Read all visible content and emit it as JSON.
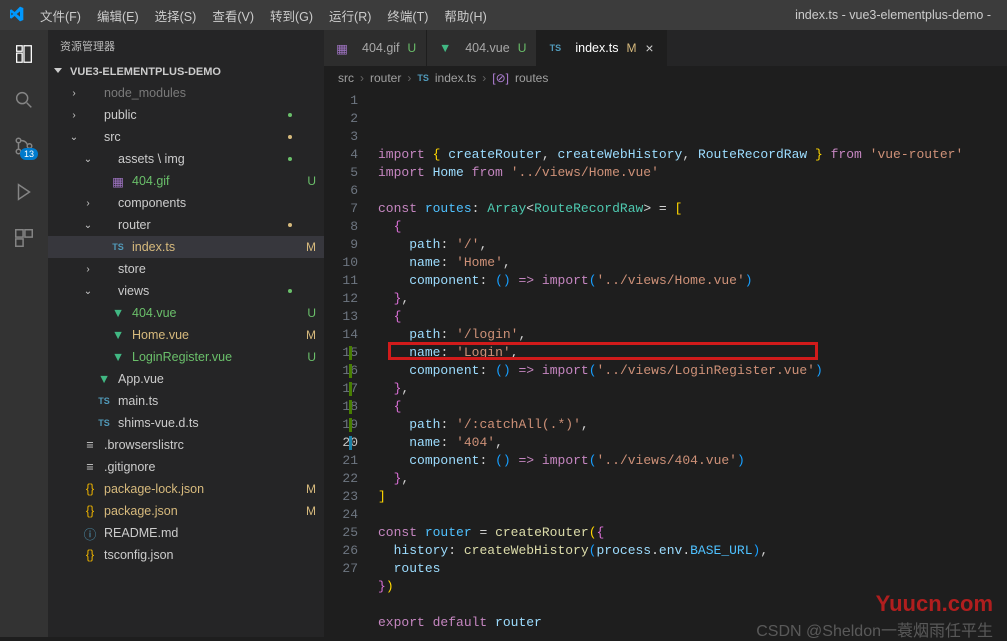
{
  "titlebar": {
    "menu": [
      "文件(F)",
      "编辑(E)",
      "选择(S)",
      "查看(V)",
      "转到(G)",
      "运行(R)",
      "终端(T)",
      "帮助(H)"
    ],
    "title": "index.ts - vue3-elementplus-demo - "
  },
  "sidebar": {
    "title": "资源管理器",
    "section": "VUE3-ELEMENTPLUS-DEMO",
    "tree": [
      {
        "d": 1,
        "tw": "›",
        "icon": "folder",
        "name": "node_modules",
        "muted": true
      },
      {
        "d": 1,
        "tw": "›",
        "icon": "folder",
        "name": "public",
        "dot": "U"
      },
      {
        "d": 1,
        "tw": "⌄",
        "icon": "folder",
        "name": "src",
        "dot": "M"
      },
      {
        "d": 2,
        "tw": "⌄",
        "icon": "folder",
        "name": "assets \\ img",
        "dot": "U"
      },
      {
        "d": 3,
        "tw": "",
        "icon": "gif",
        "name": "404.gif",
        "git": "U",
        "gcls": "gU"
      },
      {
        "d": 2,
        "tw": "›",
        "icon": "folder",
        "name": "components"
      },
      {
        "d": 2,
        "tw": "⌄",
        "icon": "folder",
        "name": "router",
        "dot": "M"
      },
      {
        "d": 3,
        "tw": "",
        "icon": "ts",
        "name": "index.ts",
        "git": "M",
        "gcls": "gM",
        "sel": true
      },
      {
        "d": 2,
        "tw": "›",
        "icon": "folder",
        "name": "store"
      },
      {
        "d": 2,
        "tw": "⌄",
        "icon": "folder",
        "name": "views",
        "dot": "U"
      },
      {
        "d": 3,
        "tw": "",
        "icon": "vue",
        "name": "404.vue",
        "git": "U",
        "gcls": "gU"
      },
      {
        "d": 3,
        "tw": "",
        "icon": "vue",
        "name": "Home.vue",
        "git": "M",
        "gcls": "gM"
      },
      {
        "d": 3,
        "tw": "",
        "icon": "vue",
        "name": "LoginRegister.vue",
        "git": "U",
        "gcls": "gU"
      },
      {
        "d": 2,
        "tw": "",
        "icon": "vue",
        "name": "App.vue"
      },
      {
        "d": 2,
        "tw": "",
        "icon": "ts",
        "name": "main.ts"
      },
      {
        "d": 2,
        "tw": "",
        "icon": "ts",
        "name": "shims-vue.d.ts"
      },
      {
        "d": 1,
        "tw": "",
        "icon": "txt",
        "name": ".browserslistrc"
      },
      {
        "d": 1,
        "tw": "",
        "icon": "txt",
        "name": ".gitignore"
      },
      {
        "d": 1,
        "tw": "",
        "icon": "json",
        "name": "package-lock.json",
        "git": "M",
        "gcls": "gM"
      },
      {
        "d": 1,
        "tw": "",
        "icon": "json",
        "name": "package.json",
        "git": "M",
        "gcls": "gM"
      },
      {
        "d": 1,
        "tw": "",
        "icon": "md",
        "name": "README.md"
      },
      {
        "d": 1,
        "tw": "",
        "icon": "json",
        "name": "tsconfig.json"
      }
    ]
  },
  "tabs": [
    {
      "icon": "gif",
      "label": "404.gif",
      "git": "U"
    },
    {
      "icon": "vue",
      "label": "404.vue",
      "git": "U"
    },
    {
      "icon": "ts",
      "label": "index.ts",
      "git": "M",
      "active": true,
      "close": true
    }
  ],
  "breadcrumbs": [
    "src",
    "router",
    "index.ts",
    "routes"
  ],
  "bcicons": [
    "",
    "",
    "ts",
    "sym"
  ],
  "lineCount": 27,
  "highlightLine": 20,
  "gdeco": {
    "15": "green",
    "16": "green",
    "17": "green",
    "18": "green",
    "19": "green",
    "20": "blue"
  },
  "code": [
    "<span class='kw'>import</span> <span class='br1'>{</span> <span class='vr'>createRouter</span><span class='pu'>,</span> <span class='vr'>createWebHistory</span><span class='pu'>,</span> <span class='vr'>RouteRecordRaw</span> <span class='br1'>}</span> <span class='kw'>from</span> <span class='st'>'vue-router'</span>",
    "<span class='kw'>import</span> <span class='vr'>Home</span> <span class='kw'>from</span> <span class='st'>'../views/Home.vue'</span>",
    "",
    "<span class='kw'>const</span> <span class='cn'>routes</span><span class='pu'>:</span> <span class='tp'>Array</span><span class='pu'>&lt;</span><span class='tp'>RouteRecordRaw</span><span class='pu'>&gt; =</span> <span class='br1'>[</span>",
    "  <span class='br2'>{</span>",
    "    <span class='vr'>path</span><span class='pu'>:</span> <span class='st'>'/'</span><span class='pu'>,</span>",
    "    <span class='vr'>name</span><span class='pu'>:</span> <span class='st'>'Home'</span><span class='pu'>,</span>",
    "    <span class='vr'>component</span><span class='pu'>:</span> <span class='br3'>(</span><span class='br3'>)</span> <span class='kw'>=&gt;</span> <span class='kw'>import</span><span class='br3'>(</span><span class='st'>'../views/Home.vue'</span><span class='br3'>)</span>",
    "  <span class='br2'>}</span><span class='pu'>,</span>",
    "  <span class='br2'>{</span>",
    "    <span class='vr'>path</span><span class='pu'>:</span> <span class='st'>'/login'</span><span class='pu'>,</span>",
    "    <span class='vr'>name</span><span class='pu'>:</span> <span class='st'>'Login'</span><span class='pu'>,</span>",
    "    <span class='vr'>component</span><span class='pu'>:</span> <span class='br3'>(</span><span class='br3'>)</span> <span class='kw'>=&gt;</span> <span class='kw'>import</span><span class='br3'>(</span><span class='st'>'../views/LoginRegister.vue'</span><span class='br3'>)</span>",
    "  <span class='br2'>}</span><span class='pu'>,</span>",
    "  <span class='br2'>{</span>",
    "    <span class='vr'>path</span><span class='pu'>:</span> <span class='st'>'/:catchAll(.*)'</span><span class='pu'>,</span>",
    "    <span class='vr'>name</span><span class='pu'>:</span> <span class='st'>'404'</span><span class='pu'>,</span>",
    "    <span class='vr'>component</span><span class='pu'>:</span> <span class='br3'>(</span><span class='br3'>)</span> <span class='kw'>=&gt;</span> <span class='kw'>import</span><span class='br3'>(</span><span class='st'>'../views/404.vue'</span><span class='br3'>)</span>",
    "  <span class='br2'>}</span><span class='pu'>,</span>",
    "<span class='br1'>]</span>",
    "",
    "<span class='kw'>const</span> <span class='cn'>router</span> <span class='pu'>=</span> <span class='fn'>createRouter</span><span class='br1'>(</span><span class='br2'>{</span>",
    "  <span class='vr'>history</span><span class='pu'>:</span> <span class='fn'>createWebHistory</span><span class='br3'>(</span><span class='vr'>process</span><span class='pu'>.</span><span class='vr'>env</span><span class='pu'>.</span><span class='cn'>BASE_URL</span><span class='br3'>)</span><span class='pu'>,</span>",
    "  <span class='vr'>routes</span>",
    "<span class='br2'>}</span><span class='br1'>)</span>",
    "",
    "<span class='kw'>export</span> <span class='kw'>default</span> <span class='vr'>router</span>"
  ],
  "watermark": "Yuucn.com",
  "csdn": "CSDN @Sheldon一蓑烟雨任平生",
  "activitybadge": "13"
}
